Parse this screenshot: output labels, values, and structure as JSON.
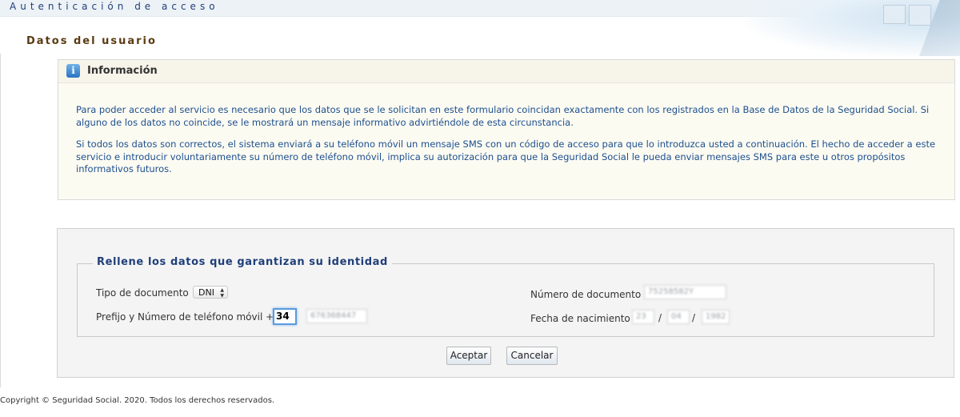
{
  "header": {
    "app_title": "Autenticación de acceso",
    "section_title": "Datos del usuario"
  },
  "info": {
    "title": "Información",
    "paragraphs": [
      "Para poder acceder al servicio es necesario que los datos que se le solicitan en este formulario coincidan exactamente con los registrados en la Base de Datos de la Seguridad Social. Si alguno de los datos no coincide, se le mostrará un mensaje informativo advirtiéndole de esta circunstancia.",
      "Si todos los datos son correctos, el sistema enviará a su teléfono móvil un mensaje SMS con un código de acceso para que lo introduzca usted a continuación. El hecho de acceder a este servicio e introducir voluntariamente su número de teléfono móvil, implica su autorización para que la Seguridad Social le pueda enviar mensajes SMS para este u otros propósitos informativos futuros."
    ]
  },
  "form": {
    "legend": "Rellene los datos que garantizan su identidad",
    "tipo_documento_label": "Tipo de documento",
    "tipo_documento_value": "DNI",
    "telefono_label": "Prefijo y Número de teléfono móvil +",
    "prefijo_value": "34",
    "telefono_value": "676368447",
    "numero_documento_label": "Número de documento",
    "numero_documento_value": "75258582Y",
    "fecha_label": "Fecha de nacimiento",
    "fecha_day": "23",
    "fecha_month": "04",
    "fecha_year": "1982",
    "date_separator": "/",
    "accept_label": "Aceptar",
    "cancel_label": "Cancelar"
  },
  "footer": {
    "copyright": "Copyright © Seguridad Social. 2020. Todos los derechos reservados."
  },
  "icons": {
    "info": "info-icon",
    "select_arrow": "updown-arrow-icon"
  },
  "colors": {
    "title_blue": "#1f3f7a",
    "section_brown": "#5b3a12",
    "info_text": "#1d4f8f"
  }
}
